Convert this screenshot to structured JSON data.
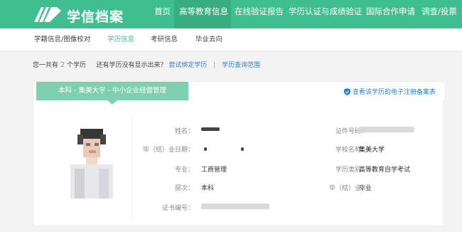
{
  "header": {
    "brand": "学信档案",
    "nav": [
      "首页",
      "高等教育信息",
      "在线验证报告",
      "学历认证与成绩验证",
      "国际合作申请",
      "调查/投票"
    ],
    "active_index": 1
  },
  "subtabs": [
    "学籍信息/图像校对",
    "学历信息",
    "考研信息",
    "毕业去向"
  ],
  "subtab_active": 1,
  "info": {
    "prefix": "您一共有",
    "count": "2",
    "suffix": "个学历",
    "question": "还有学历没有显示出来？",
    "link1": "尝试绑定学历",
    "divider": "|",
    "link2": "学历查询范围"
  },
  "card": {
    "degree_tab": "本科 - 集美大学 - 中小企业经营管理",
    "cert_link": "查看该学历的电子注册备案表",
    "fields": {
      "name_label": "姓名：",
      "graduation_date_label": "毕（结）业日期：",
      "major_label": "专业：",
      "major_value": "工商管理",
      "level_label": "层次：",
      "level_value": "本科",
      "cert_no_label": "证书编号：",
      "id_label": "证件号码：",
      "school_label": "学校名称：",
      "school_value": "集美大学",
      "category_label": "学历类别：",
      "category_value": "高等教育自学考试",
      "status_label": "毕（结）业：",
      "status_value": "毕业"
    }
  },
  "colors": {
    "brand_green": "#3fbf8f",
    "tab_green": "#7fd0b0",
    "link_blue": "#2a83d2"
  }
}
